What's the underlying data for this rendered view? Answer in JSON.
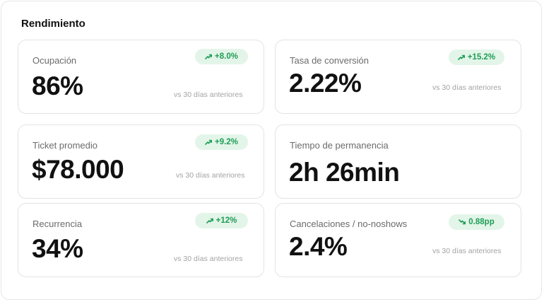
{
  "title": "Rendimiento",
  "cards": [
    {
      "label": "Ocupación",
      "value": "86%",
      "badge": "+8.0%",
      "trend": "up",
      "compare": "vs 30 días anteriores"
    },
    {
      "label": "Tasa de conversión",
      "value": "2.22%",
      "badge": "+15.2%",
      "trend": "up",
      "compare": "vs 30 días anteriores"
    },
    {
      "label": "Ticket promedio",
      "value": "$78.000",
      "badge": "+9.2%",
      "trend": "up",
      "compare": "vs 30 días anteriores"
    },
    {
      "label": "Tiempo de permanencia",
      "value": "2h 26min"
    },
    {
      "label": "Recurrencia",
      "value": "34%",
      "badge": "+12%",
      "trend": "up",
      "compare": "vs 30 días anteriores"
    },
    {
      "label": "Cancelaciones / no-noshows",
      "value": "2.4%",
      "badge": "0.88pp",
      "trend": "down",
      "compare": "vs 30 días anteriores"
    }
  ],
  "colors": {
    "badge_bg": "#e3f5e9",
    "badge_text": "#1f9d55",
    "value_text": "#111111",
    "label_text": "#6b6b6b",
    "muted_text": "#a3a3a3"
  },
  "icons": {
    "up": "trending-up-icon",
    "down": "trending-down-icon"
  }
}
